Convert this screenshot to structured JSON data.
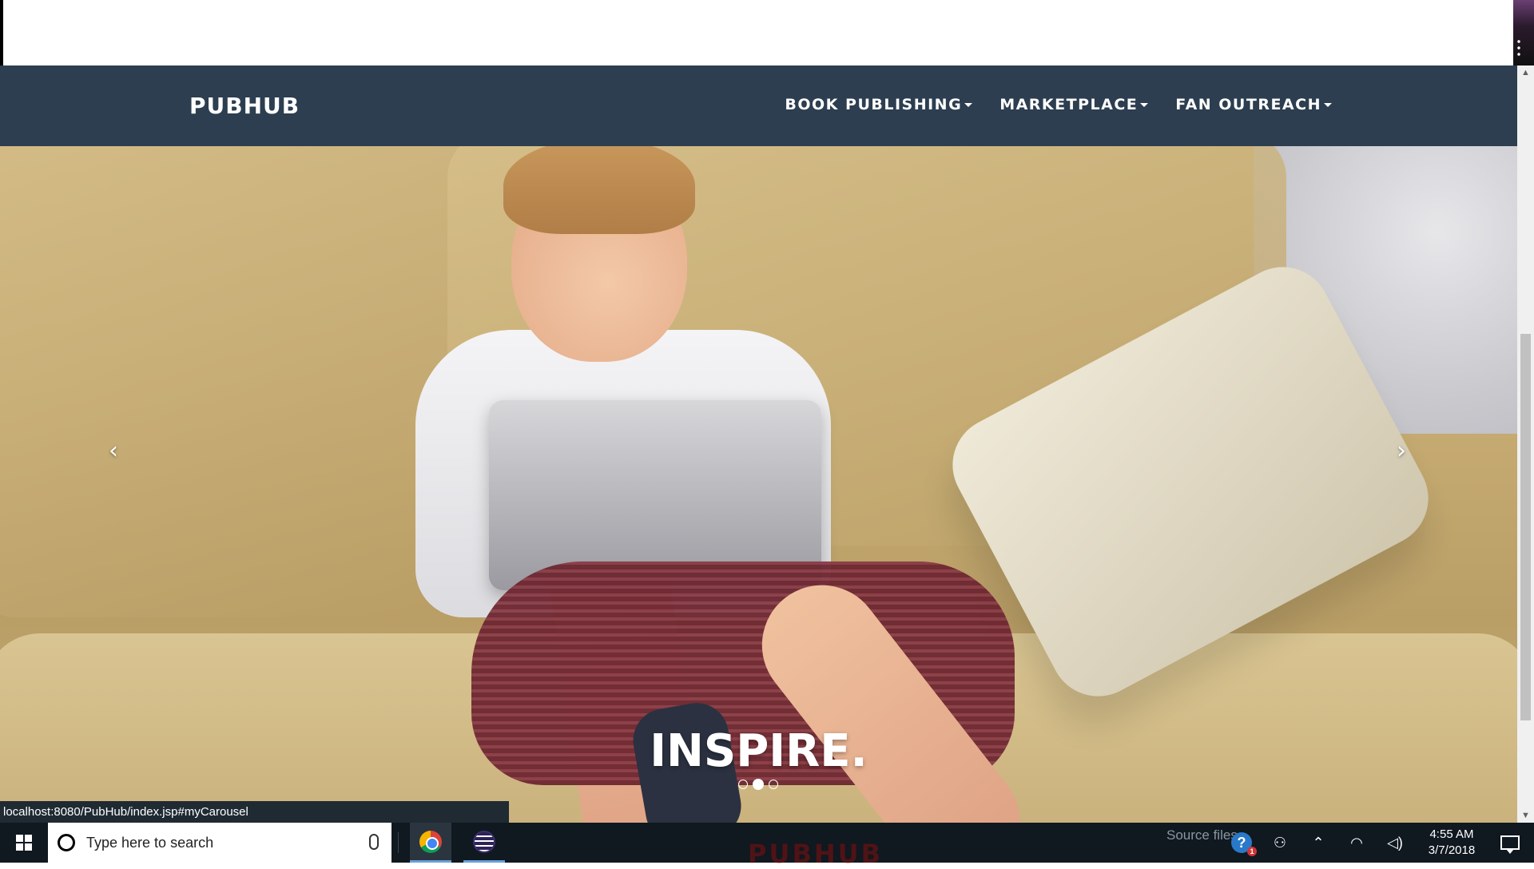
{
  "navbar": {
    "brand": "PUBHUB",
    "menu": [
      {
        "label": "BOOK PUBLISHING"
      },
      {
        "label": "MARKETPLACE"
      },
      {
        "label": "FAN OUTREACH"
      }
    ]
  },
  "carousel": {
    "caption": "INSPIRE.",
    "prev_glyph": "‹",
    "next_glyph": "›",
    "indicators": 3,
    "active_index": 1
  },
  "status_url": "localhost:8080/PubHub/index.jsp#myCarousel",
  "taskbar": {
    "search_placeholder": "Type here to search",
    "ghost_text": "PUBHUB",
    "source_files": "Source files",
    "time": "4:55 AM",
    "date": "3/7/2018"
  },
  "scrollbar": {
    "up": "▲",
    "down": "▼"
  }
}
